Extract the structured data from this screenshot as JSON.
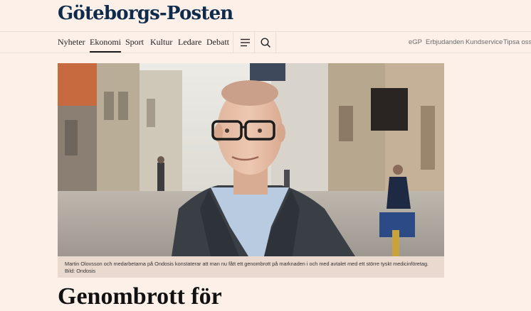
{
  "site": {
    "logo": "Göteborgs-Posten"
  },
  "nav": {
    "items": [
      {
        "label": "Nyheter"
      },
      {
        "label": "Ekonomi",
        "active": true
      },
      {
        "label": "Sport"
      },
      {
        "label": "Kultur"
      },
      {
        "label": "Ledare"
      },
      {
        "label": "Debatt"
      }
    ],
    "menu_icon": "hamburger-menu-icon",
    "search_icon": "search-icon",
    "right_links": [
      "eGP",
      "Erbjudanden",
      "Kundservice",
      "Tipsa oss"
    ]
  },
  "article": {
    "image_caption": "Martin Olovsson och medarbetarna på Ondosis konstaterar att man nu fått ett genombrott på marknaden i och med avtalet med ett större tyskt medicinföretag.",
    "image_credit": "Bild: Ondosis",
    "headline": "Genombrott för"
  },
  "colors": {
    "page_bg": "#fdf0e9",
    "logo": "#0f2b4c",
    "caption_bg": "#ead9cf"
  }
}
